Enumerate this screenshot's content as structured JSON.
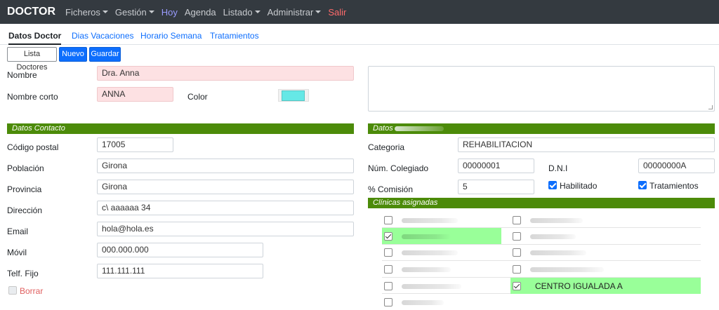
{
  "navbar": {
    "brand": "DOCTOR",
    "items": [
      {
        "label": "Ficheros",
        "dropdown": true
      },
      {
        "label": "Gestión",
        "dropdown": true
      },
      {
        "label": "Hoy",
        "dropdown": false
      },
      {
        "label": "Agenda",
        "dropdown": false
      },
      {
        "label": "Listado",
        "dropdown": true
      },
      {
        "label": "Administrar",
        "dropdown": true
      },
      {
        "label": "Salir",
        "dropdown": false
      }
    ]
  },
  "tabs": [
    {
      "label": "Datos Doctor",
      "active": true
    },
    {
      "label": "Dias Vacaciones",
      "active": false
    },
    {
      "label": "Horario Semana",
      "active": false
    },
    {
      "label": "Tratamientos",
      "active": false
    }
  ],
  "toolbar": {
    "list_label": "Lista Doctores",
    "new_label": "Nuevo",
    "save_label": "Guardar"
  },
  "form": {
    "nombre_label": "Nombre",
    "nombre_value": "Dra. Anna",
    "nombre_corto_label": "Nombre corto",
    "nombre_corto_value": "ANNA",
    "color_label": "Color",
    "color_value": "#66e8e6",
    "notes_value": ""
  },
  "contacto": {
    "section_title": "Datos Contacto",
    "codigo_postal_label": "Código postal",
    "codigo_postal_value": "17005",
    "poblacion_label": "Población",
    "poblacion_value": "Girona",
    "provincia_label": "Provincia",
    "provincia_value": "Girona",
    "direccion_label": "Dirección",
    "direccion_value": "c\\ aaaaaa 34",
    "email_label": "Email",
    "email_value": "hola@hola.es",
    "movil_label": "Móvil",
    "movil_value": "000.000.000",
    "telf_label": "Telf. Fijo",
    "telf_value": "111.111.111",
    "borrar_label": "Borrar"
  },
  "datos": {
    "section_title": "Datos",
    "categoria_label": "Categoria",
    "categoria_value": "REHABILITACION",
    "colegiado_label": "Núm. Colegiado",
    "colegiado_value": "00000001",
    "dni_label": "D.N.I",
    "dni_value": "00000000A",
    "comision_label": "% Comisión",
    "comision_value": "5",
    "habilitado_label": "Habilitado",
    "tratamientos_label": "Tratamientos"
  },
  "clinicas": {
    "section_title": "Clínicas asignadas",
    "named_clinic": "CENTRO IGUALADA A"
  },
  "colors": {
    "navbar_bg": "#343a40",
    "section_green": "#4c8b09",
    "selected_clinic_bg": "#99ff99",
    "required_field_bg": "#fde1e3",
    "primary_blue": "#0d6efd"
  }
}
